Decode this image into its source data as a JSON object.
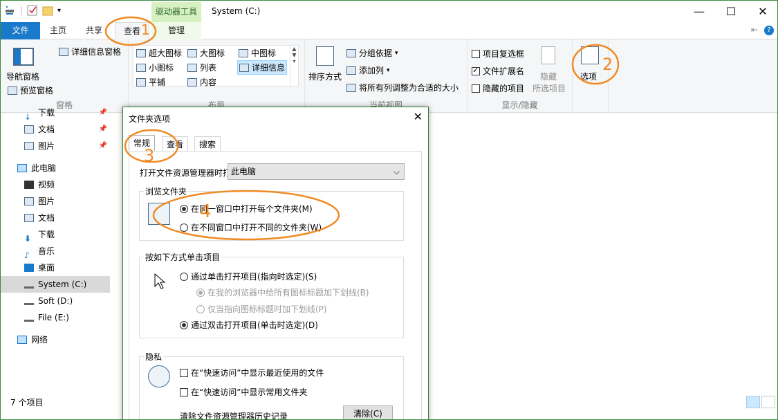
{
  "window": {
    "title": "System (C:)",
    "contextual_tab": "驱动器工具",
    "controls": {
      "minimize": "—",
      "maximize": "☐",
      "close": "✕"
    }
  },
  "tabs": {
    "file": "文件",
    "home": "主页",
    "share": "共享",
    "view": "查看",
    "manage": "管理"
  },
  "ribbon": {
    "panes": {
      "nav_pane": "导航窗格",
      "preview_pane": "预览窗格",
      "details_pane": "详细信息窗格",
      "group_label": "窗格"
    },
    "layout": {
      "items": [
        "超大图标",
        "大图标",
        "中图标",
        "小图标",
        "列表",
        "详细信息",
        "平铺",
        "内容"
      ],
      "group_label": "布局",
      "selected": "详细信息"
    },
    "current_view": {
      "sort_by": "排序方式",
      "group_by": "分组依据",
      "add_column": "添加列",
      "fit_columns": "将所有列调整为合适的大小",
      "group_label": "当前视图"
    },
    "show_hide": {
      "item_checkboxes": "项目复选框",
      "file_extensions": "文件扩展名",
      "hidden_items": "隐藏的项目",
      "hide_selected": "隐藏",
      "hide_selected_2": "所选项目",
      "group_label": "显示/隐藏"
    },
    "options": "选项"
  },
  "nav": {
    "items": [
      {
        "label": "下载",
        "pin": true
      },
      {
        "label": "文档",
        "pin": true
      },
      {
        "label": "图片",
        "pin": true
      },
      {
        "label": "此电脑",
        "pin": false
      },
      {
        "label": "视频",
        "pin": false
      },
      {
        "label": "图片",
        "pin": false
      },
      {
        "label": "文档",
        "pin": false
      },
      {
        "label": "下载",
        "pin": false
      },
      {
        "label": "音乐",
        "pin": false
      },
      {
        "label": "桌面",
        "pin": false
      },
      {
        "label": "System (C:)",
        "pin": false
      },
      {
        "label": "Soft (D:)",
        "pin": false
      },
      {
        "label": "File (E:)",
        "pin": false
      },
      {
        "label": "网络",
        "pin": false
      }
    ]
  },
  "status": {
    "count": "7 个项目"
  },
  "dialog": {
    "title": "文件夹选项",
    "close": "✕",
    "tabs": [
      "常规",
      "查看",
      "搜索"
    ],
    "open_in_label": "打开文件资源管理器时打",
    "open_in_value": "此电脑",
    "browse": {
      "legend": "浏览文件夹",
      "same_window": "在同一窗口中打开每个文件夹(M)",
      "new_window": "在不同窗口中打开不同的文件夹(W)"
    },
    "click": {
      "legend": "按如下方式单击项目",
      "single": "通过单击打开项目(指向时选定)(S)",
      "underline_all": "在我的浏览器中给所有图标标题加下划线(B)",
      "underline_hover": "仅当指向图标标题时加下划线(P)",
      "double": "通过双击打开项目(单击时选定)(D)"
    },
    "privacy": {
      "legend": "隐私",
      "recent_files": "在“快速访问”中显示最近使用的文件",
      "frequent_folders": "在“快速访问”中显示常用文件夹",
      "clear_label": "清除文件资源管理器历史记录",
      "clear_button": "清除(C)"
    }
  },
  "annotations": [
    "1",
    "2",
    "3",
    "4"
  ],
  "colors": {
    "annotation": "#f08a24",
    "accent": "#1979ca",
    "context": "#d6f0c2"
  }
}
